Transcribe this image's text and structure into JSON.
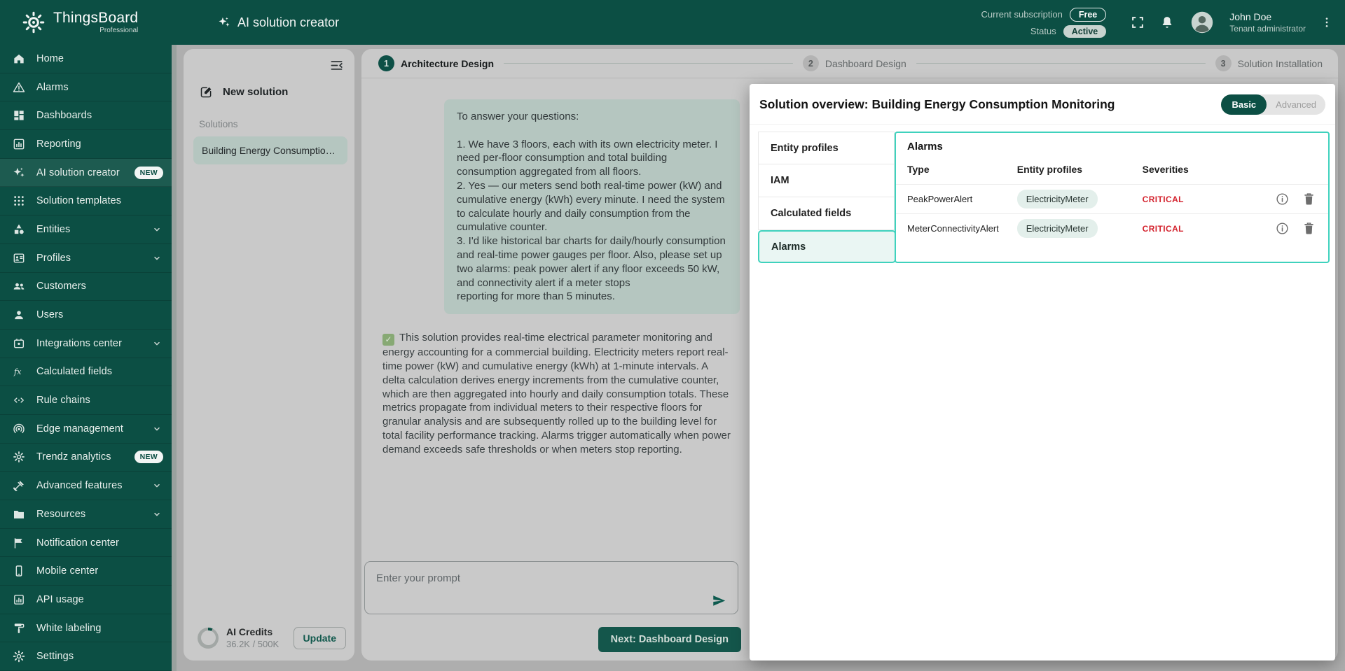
{
  "colors": {
    "primary": "#0c4f44",
    "accent_teal": "#3fd2bd",
    "critical_red": "#d4232e",
    "chip_bg": "#e3efeb",
    "bubble_bg": "#b5c6c0"
  },
  "topbar": {
    "brand_name": "ThingsBoard",
    "brand_sub": "Professional",
    "page_title": "AI solution creator",
    "subscription_label": "Current subscription",
    "subscription_value": "Free",
    "status_label": "Status",
    "status_value": "Active",
    "user_name": "John Doe",
    "user_role": "Tenant administrator",
    "icons": [
      "fullscreen-icon",
      "notifications-bell-icon",
      "avatar",
      "kebab-menu-icon"
    ]
  },
  "sidebar": {
    "items": [
      {
        "label": "Home",
        "icon": "home"
      },
      {
        "label": "Alarms",
        "icon": "alarms"
      },
      {
        "label": "Dashboards",
        "icon": "dashboards"
      },
      {
        "label": "Reporting",
        "icon": "reporting"
      },
      {
        "label": "AI solution creator",
        "icon": "ai-sparkle",
        "active": true,
        "badge": "NEW"
      },
      {
        "label": "Solution templates",
        "icon": "dot-grid"
      },
      {
        "label": "Entities",
        "icon": "entities",
        "chevron": true
      },
      {
        "label": "Profiles",
        "icon": "id-badge",
        "chevron": true
      },
      {
        "label": "Customers",
        "icon": "people"
      },
      {
        "label": "Users",
        "icon": "person"
      },
      {
        "label": "Integrations center",
        "icon": "integration",
        "chevron": true
      },
      {
        "label": "Calculated fields",
        "icon": "function"
      },
      {
        "label": "Rule chains",
        "icon": "rule-chain"
      },
      {
        "label": "Edge management",
        "icon": "edge-antenna",
        "chevron": true
      },
      {
        "label": "Trendz analytics",
        "icon": "trendz-gear",
        "badge": "NEW"
      },
      {
        "label": "Advanced features",
        "icon": "tools",
        "chevron": true
      },
      {
        "label": "Resources",
        "icon": "folder",
        "chevron": true
      },
      {
        "label": "Notification center",
        "icon": "notification-flag"
      },
      {
        "label": "Mobile center",
        "icon": "mobile-phone"
      },
      {
        "label": "API usage",
        "icon": "api-chart"
      },
      {
        "label": "White labeling",
        "icon": "paint-roller"
      },
      {
        "label": "Settings",
        "icon": "gear"
      }
    ]
  },
  "solutions_panel": {
    "new_solution_label": "New solution",
    "section_label": "Solutions",
    "items": [
      {
        "title": "Building Energy Consumption …",
        "selected": true
      }
    ],
    "credits": {
      "label": "AI Credits",
      "value": "36.2K / 500K",
      "update_label": "Update",
      "used_percent": 7.2
    }
  },
  "stepper": {
    "steps": [
      {
        "number": "1",
        "label": "Architecture Design",
        "active": true
      },
      {
        "number": "2",
        "label": "Dashboard Design",
        "active": false
      },
      {
        "number": "3",
        "label": "Solution Installation",
        "active": false
      }
    ]
  },
  "chat": {
    "user_message": "To answer your questions:\n\n1. We have 3 floors, each with its own electricity meter. I need per-floor consumption and total building consumption aggregated from all floors.\n2. Yes — our meters send both real-time power (kW) and cumulative energy (kWh) every minute. I need the system to calculate hourly and daily consumption from the cumulative counter.\n3. I'd like historical bar charts for daily/hourly consumption and real-time power gauges per floor. Also, please set up two alarms: peak power alert if any floor exceeds 50 kW, and connectivity alert if a meter stops\nreporting for more than 5 minutes.",
    "assistant_check": "✓",
    "assistant_message": "This solution provides real-time electrical parameter monitoring and energy accounting for a commercial building. Electricity meters report real-time power (kW) and cumulative energy (kWh) at 1-minute intervals. A delta calculation derives energy increments from the cumulative counter, which are then aggregated into hourly and daily consumption totals. These metrics propagate from individual meters to their respective floors for granular analysis and are subsequently rolled up to the building level for total facility performance tracking. Alarms trigger automatically when power demand exceeds safe thresholds or when meters stop reporting.",
    "prompt_placeholder": "Enter your prompt",
    "next_button_label": "Next: Dashboard Design"
  },
  "overview": {
    "title": "Solution overview: Building Energy Consumption Monitoring",
    "toggle": {
      "basic": "Basic",
      "advanced": "Advanced",
      "selected": "Basic"
    },
    "tabs": [
      {
        "label": "Entity profiles",
        "active": false
      },
      {
        "label": "IAM",
        "active": false
      },
      {
        "label": "Calculated fields",
        "active": false
      },
      {
        "label": "Alarms",
        "active": true
      }
    ],
    "alarms": {
      "heading": "Alarms",
      "columns": [
        "Type",
        "Entity profiles",
        "Severities"
      ],
      "rows": [
        {
          "type": "PeakPowerAlert",
          "entity_profile": "ElectricityMeter",
          "severity": "CRITICAL"
        },
        {
          "type": "MeterConnectivityAlert",
          "entity_profile": "ElectricityMeter",
          "severity": "CRITICAL"
        }
      ]
    }
  }
}
